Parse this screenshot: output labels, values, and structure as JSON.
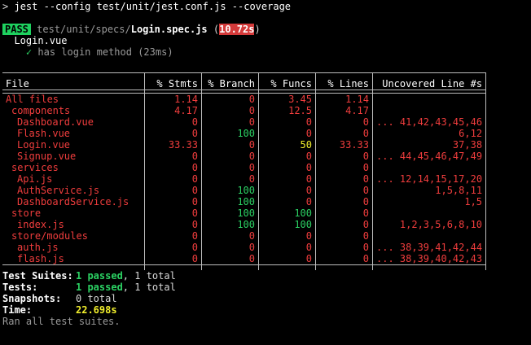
{
  "command": {
    "prompt": ">",
    "text": "jest --config test/unit/jest.conf.js --coverage"
  },
  "result": {
    "badge": "PASS",
    "spec_dir": "test/unit/specs/",
    "spec_file": "Login.spec.js",
    "duration_open": "(",
    "duration": "10.72s",
    "duration_close": ")",
    "suite": "Login.vue",
    "test_check": "✓",
    "test_name": "has login method (23ms)"
  },
  "table": {
    "headers": [
      "File",
      "% Stmts",
      "% Branch",
      "% Funcs",
      "% Lines",
      "Uncovered Line #s"
    ],
    "rows": [
      {
        "file": "All files",
        "indent": 0,
        "stmts": "1.14",
        "branch": "0",
        "funcs": "3.45",
        "lines": "1.14",
        "uncovered": ""
      },
      {
        "file": "components",
        "indent": 1,
        "stmts": "4.17",
        "branch": "0",
        "funcs": "12.5",
        "lines": "4.17",
        "uncovered": ""
      },
      {
        "file": "Dashboard.vue",
        "indent": 2,
        "stmts": "0",
        "branch": "0",
        "funcs": "0",
        "lines": "0",
        "uncovered": "... 41,42,43,45,46"
      },
      {
        "file": "Flash.vue",
        "indent": 2,
        "stmts": "0",
        "branch": "100",
        "funcs": "0",
        "lines": "0",
        "uncovered": "6,12"
      },
      {
        "file": "Login.vue",
        "indent": 2,
        "stmts": "33.33",
        "branch": "0",
        "funcs": "50",
        "lines": "33.33",
        "uncovered": "37,38"
      },
      {
        "file": "Signup.vue",
        "indent": 2,
        "stmts": "0",
        "branch": "0",
        "funcs": "0",
        "lines": "0",
        "uncovered": "... 44,45,46,47,49"
      },
      {
        "file": "services",
        "indent": 1,
        "stmts": "0",
        "branch": "0",
        "funcs": "0",
        "lines": "0",
        "uncovered": ""
      },
      {
        "file": "Api.js",
        "indent": 2,
        "stmts": "0",
        "branch": "0",
        "funcs": "0",
        "lines": "0",
        "uncovered": "... 12,14,15,17,20"
      },
      {
        "file": "AuthService.js",
        "indent": 2,
        "stmts": "0",
        "branch": "100",
        "funcs": "0",
        "lines": "0",
        "uncovered": "1,5,8,11"
      },
      {
        "file": "DashboardService.js",
        "indent": 2,
        "stmts": "0",
        "branch": "100",
        "funcs": "0",
        "lines": "0",
        "uncovered": "1,5"
      },
      {
        "file": "store",
        "indent": 1,
        "stmts": "0",
        "branch": "100",
        "funcs": "100",
        "lines": "0",
        "uncovered": ""
      },
      {
        "file": "index.js",
        "indent": 2,
        "stmts": "0",
        "branch": "100",
        "funcs": "100",
        "lines": "0",
        "uncovered": "1,2,3,5,6,8,10"
      },
      {
        "file": "store/modules",
        "indent": 1,
        "stmts": "0",
        "branch": "0",
        "funcs": "0",
        "lines": "0",
        "uncovered": ""
      },
      {
        "file": "auth.js",
        "indent": 2,
        "stmts": "0",
        "branch": "0",
        "funcs": "0",
        "lines": "0",
        "uncovered": "... 38,39,41,42,44"
      },
      {
        "file": "flash.js",
        "indent": 2,
        "stmts": "0",
        "branch": "0",
        "funcs": "0",
        "lines": "0",
        "uncovered": "... 38,39,40,42,43"
      }
    ]
  },
  "summary": {
    "suites_label": "Test Suites:",
    "suites_passed": "1 passed",
    "suites_total": ", 1 total",
    "tests_label": "Tests:",
    "tests_passed": "1 passed",
    "tests_total": ", 1 total",
    "snapshots_label": "Snapshots:",
    "snapshots_value": "0 total",
    "time_label": "Time:",
    "time_value": "22.698s",
    "footer": "Ran all test suites."
  },
  "colors": {
    "pass_bg": "#1ed15f",
    "fail_red": "#f03d3d",
    "ok_green": "#2bd163",
    "warn_yellow": "#f2ef2c",
    "background": "#000000"
  }
}
